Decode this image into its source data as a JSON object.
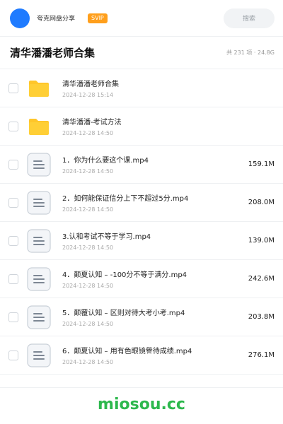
{
  "header": {
    "username": "夸克网盘分享",
    "vip_badge": "SVIP",
    "search_placeholder": "搜索",
    "accent": "#1f7bff"
  },
  "title_bar": {
    "title": "清华潘潘老师合集",
    "summary": "共 231 项 · 24.8G"
  },
  "files": [
    {
      "icon": "folder-icon",
      "name": "清华潘潘老师合集",
      "date": "2024-12-28 15:14",
      "size": ""
    },
    {
      "icon": "folder-icon",
      "name": "清华潘潘-考试方法",
      "date": "2024-12-28 14:50",
      "size": ""
    },
    {
      "icon": "file-icon",
      "name": "1．你为什么要这个课.mp4",
      "date": "2024-12-28 14:50",
      "size": "159.1M"
    },
    {
      "icon": "file-icon",
      "name": "2．如何能保证信分上下不超过5分.mp4",
      "date": "2024-12-28 14:50",
      "size": "208.0M"
    },
    {
      "icon": "file-icon",
      "name": "3.认和考试不等于学习.mp4",
      "date": "2024-12-28 14:50",
      "size": "139.0M"
    },
    {
      "icon": "file-icon",
      "name": "4．颠夏认知 – -100分不等于满分.mp4",
      "date": "2024-12-28 14:50",
      "size": "242.6M"
    },
    {
      "icon": "file-icon",
      "name": "5．颠覆认知 – 区则对待大考小考.mp4",
      "date": "2024-12-28 14:50",
      "size": "203.8M"
    },
    {
      "icon": "file-icon",
      "name": "6．颠夏认知 – 用有色眼镜譽待成绩.mp4",
      "date": "2024-12-28 14:50",
      "size": "276.1M"
    }
  ],
  "watermark": "miosou.cc"
}
